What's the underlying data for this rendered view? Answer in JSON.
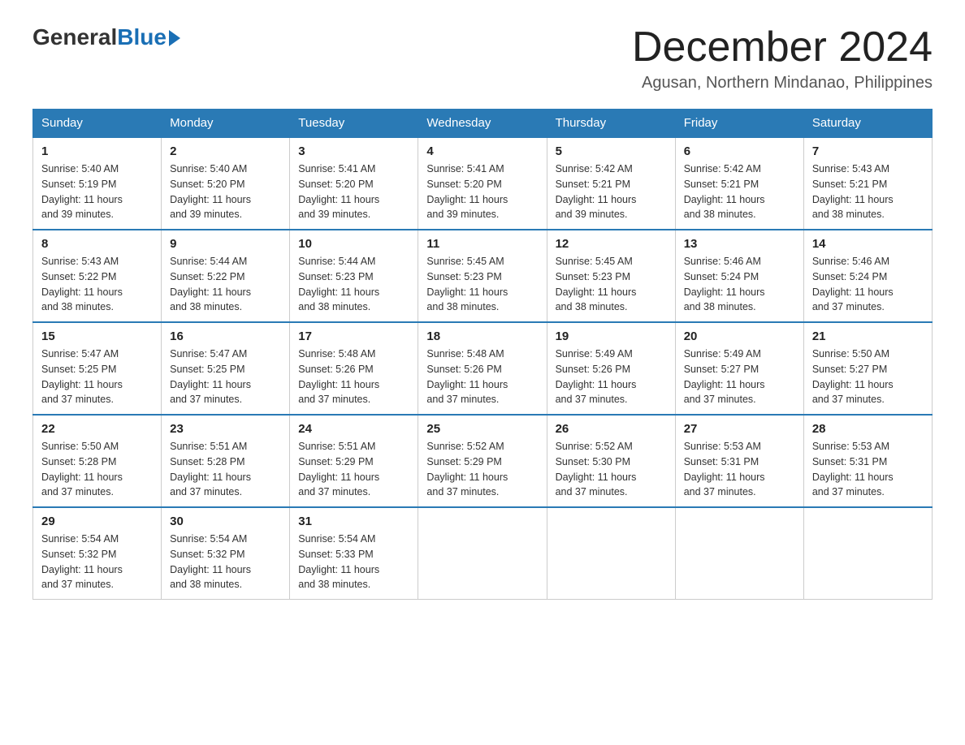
{
  "header": {
    "logo_general": "General",
    "logo_blue": "Blue",
    "month_year": "December 2024",
    "location": "Agusan, Northern Mindanao, Philippines"
  },
  "days_of_week": [
    "Sunday",
    "Monday",
    "Tuesday",
    "Wednesday",
    "Thursday",
    "Friday",
    "Saturday"
  ],
  "weeks": [
    [
      {
        "day": "1",
        "sunrise": "5:40 AM",
        "sunset": "5:19 PM",
        "daylight": "11 hours and 39 minutes."
      },
      {
        "day": "2",
        "sunrise": "5:40 AM",
        "sunset": "5:20 PM",
        "daylight": "11 hours and 39 minutes."
      },
      {
        "day": "3",
        "sunrise": "5:41 AM",
        "sunset": "5:20 PM",
        "daylight": "11 hours and 39 minutes."
      },
      {
        "day": "4",
        "sunrise": "5:41 AM",
        "sunset": "5:20 PM",
        "daylight": "11 hours and 39 minutes."
      },
      {
        "day": "5",
        "sunrise": "5:42 AM",
        "sunset": "5:21 PM",
        "daylight": "11 hours and 39 minutes."
      },
      {
        "day": "6",
        "sunrise": "5:42 AM",
        "sunset": "5:21 PM",
        "daylight": "11 hours and 38 minutes."
      },
      {
        "day": "7",
        "sunrise": "5:43 AM",
        "sunset": "5:21 PM",
        "daylight": "11 hours and 38 minutes."
      }
    ],
    [
      {
        "day": "8",
        "sunrise": "5:43 AM",
        "sunset": "5:22 PM",
        "daylight": "11 hours and 38 minutes."
      },
      {
        "day": "9",
        "sunrise": "5:44 AM",
        "sunset": "5:22 PM",
        "daylight": "11 hours and 38 minutes."
      },
      {
        "day": "10",
        "sunrise": "5:44 AM",
        "sunset": "5:23 PM",
        "daylight": "11 hours and 38 minutes."
      },
      {
        "day": "11",
        "sunrise": "5:45 AM",
        "sunset": "5:23 PM",
        "daylight": "11 hours and 38 minutes."
      },
      {
        "day": "12",
        "sunrise": "5:45 AM",
        "sunset": "5:23 PM",
        "daylight": "11 hours and 38 minutes."
      },
      {
        "day": "13",
        "sunrise": "5:46 AM",
        "sunset": "5:24 PM",
        "daylight": "11 hours and 38 minutes."
      },
      {
        "day": "14",
        "sunrise": "5:46 AM",
        "sunset": "5:24 PM",
        "daylight": "11 hours and 37 minutes."
      }
    ],
    [
      {
        "day": "15",
        "sunrise": "5:47 AM",
        "sunset": "5:25 PM",
        "daylight": "11 hours and 37 minutes."
      },
      {
        "day": "16",
        "sunrise": "5:47 AM",
        "sunset": "5:25 PM",
        "daylight": "11 hours and 37 minutes."
      },
      {
        "day": "17",
        "sunrise": "5:48 AM",
        "sunset": "5:26 PM",
        "daylight": "11 hours and 37 minutes."
      },
      {
        "day": "18",
        "sunrise": "5:48 AM",
        "sunset": "5:26 PM",
        "daylight": "11 hours and 37 minutes."
      },
      {
        "day": "19",
        "sunrise": "5:49 AM",
        "sunset": "5:26 PM",
        "daylight": "11 hours and 37 minutes."
      },
      {
        "day": "20",
        "sunrise": "5:49 AM",
        "sunset": "5:27 PM",
        "daylight": "11 hours and 37 minutes."
      },
      {
        "day": "21",
        "sunrise": "5:50 AM",
        "sunset": "5:27 PM",
        "daylight": "11 hours and 37 minutes."
      }
    ],
    [
      {
        "day": "22",
        "sunrise": "5:50 AM",
        "sunset": "5:28 PM",
        "daylight": "11 hours and 37 minutes."
      },
      {
        "day": "23",
        "sunrise": "5:51 AM",
        "sunset": "5:28 PM",
        "daylight": "11 hours and 37 minutes."
      },
      {
        "day": "24",
        "sunrise": "5:51 AM",
        "sunset": "5:29 PM",
        "daylight": "11 hours and 37 minutes."
      },
      {
        "day": "25",
        "sunrise": "5:52 AM",
        "sunset": "5:29 PM",
        "daylight": "11 hours and 37 minutes."
      },
      {
        "day": "26",
        "sunrise": "5:52 AM",
        "sunset": "5:30 PM",
        "daylight": "11 hours and 37 minutes."
      },
      {
        "day": "27",
        "sunrise": "5:53 AM",
        "sunset": "5:31 PM",
        "daylight": "11 hours and 37 minutes."
      },
      {
        "day": "28",
        "sunrise": "5:53 AM",
        "sunset": "5:31 PM",
        "daylight": "11 hours and 37 minutes."
      }
    ],
    [
      {
        "day": "29",
        "sunrise": "5:54 AM",
        "sunset": "5:32 PM",
        "daylight": "11 hours and 37 minutes."
      },
      {
        "day": "30",
        "sunrise": "5:54 AM",
        "sunset": "5:32 PM",
        "daylight": "11 hours and 38 minutes."
      },
      {
        "day": "31",
        "sunrise": "5:54 AM",
        "sunset": "5:33 PM",
        "daylight": "11 hours and 38 minutes."
      },
      null,
      null,
      null,
      null
    ]
  ],
  "labels": {
    "sunrise": "Sunrise:",
    "sunset": "Sunset:",
    "daylight": "Daylight:"
  }
}
